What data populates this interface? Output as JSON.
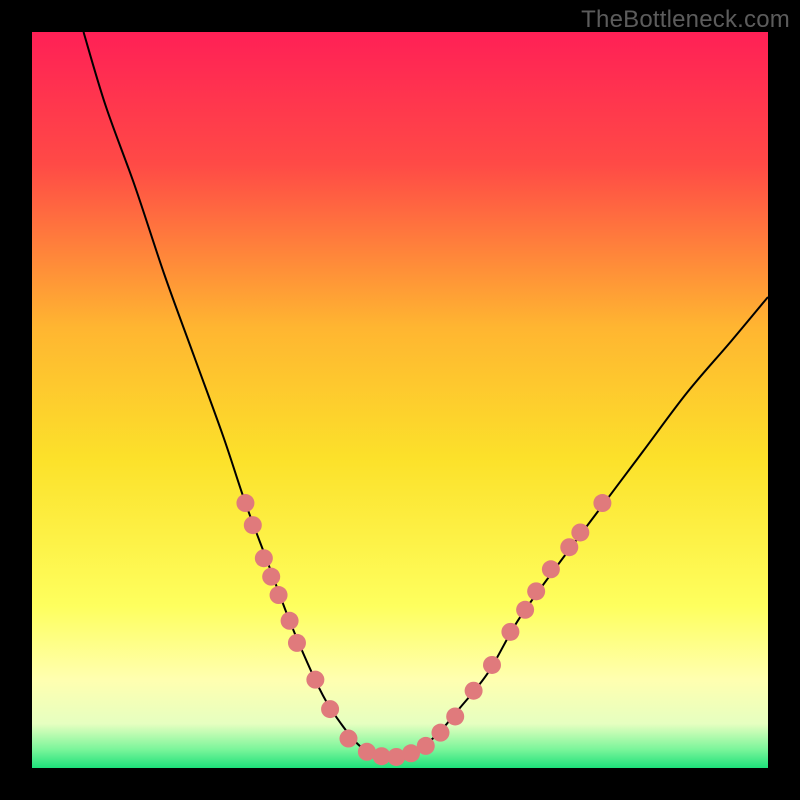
{
  "attribution": "TheBottleneck.com",
  "chart_data": {
    "type": "line",
    "title": "",
    "xlabel": "",
    "ylabel": "",
    "xlim": [
      0,
      100
    ],
    "ylim": [
      0,
      100
    ],
    "legend": false,
    "grid": false,
    "background_gradient_stops": [
      {
        "offset": 0.0,
        "color": "#ff2056"
      },
      {
        "offset": 0.18,
        "color": "#ff4a46"
      },
      {
        "offset": 0.4,
        "color": "#ffb531"
      },
      {
        "offset": 0.58,
        "color": "#fce12a"
      },
      {
        "offset": 0.78,
        "color": "#feff5e"
      },
      {
        "offset": 0.88,
        "color": "#ffffb0"
      },
      {
        "offset": 0.94,
        "color": "#e6ffc0"
      },
      {
        "offset": 0.975,
        "color": "#7af59a"
      },
      {
        "offset": 1.0,
        "color": "#1ee07a"
      }
    ],
    "series": [
      {
        "name": "bottleneck-curve",
        "x": [
          7,
          10,
          14,
          18,
          22,
          26,
          29,
          32,
          35,
          38,
          40,
          42,
          44,
          46,
          48,
          50,
          52,
          55,
          58,
          62,
          66,
          71,
          77,
          83,
          89,
          95,
          100
        ],
        "y": [
          100,
          90,
          79,
          67,
          56,
          45,
          36,
          28,
          20,
          13,
          9,
          6,
          3.5,
          2,
          1.5,
          1.5,
          2.2,
          4.5,
          8,
          13,
          20,
          27,
          35,
          43,
          51,
          58,
          64
        ]
      }
    ],
    "markers": [
      {
        "x": 29.0,
        "y": 36.0
      },
      {
        "x": 30.0,
        "y": 33.0
      },
      {
        "x": 31.5,
        "y": 28.5
      },
      {
        "x": 32.5,
        "y": 26.0
      },
      {
        "x": 33.5,
        "y": 23.5
      },
      {
        "x": 35.0,
        "y": 20.0
      },
      {
        "x": 36.0,
        "y": 17.0
      },
      {
        "x": 38.5,
        "y": 12.0
      },
      {
        "x": 40.5,
        "y": 8.0
      },
      {
        "x": 43.0,
        "y": 4.0
      },
      {
        "x": 45.5,
        "y": 2.2
      },
      {
        "x": 47.5,
        "y": 1.6
      },
      {
        "x": 49.5,
        "y": 1.5
      },
      {
        "x": 51.5,
        "y": 2.0
      },
      {
        "x": 53.5,
        "y": 3.0
      },
      {
        "x": 55.5,
        "y": 4.8
      },
      {
        "x": 57.5,
        "y": 7.0
      },
      {
        "x": 60.0,
        "y": 10.5
      },
      {
        "x": 62.5,
        "y": 14.0
      },
      {
        "x": 65.0,
        "y": 18.5
      },
      {
        "x": 67.0,
        "y": 21.5
      },
      {
        "x": 68.5,
        "y": 24.0
      },
      {
        "x": 70.5,
        "y": 27.0
      },
      {
        "x": 73.0,
        "y": 30.0
      },
      {
        "x": 74.5,
        "y": 32.0
      },
      {
        "x": 77.5,
        "y": 36.0
      }
    ],
    "marker_radius_px": 9
  }
}
